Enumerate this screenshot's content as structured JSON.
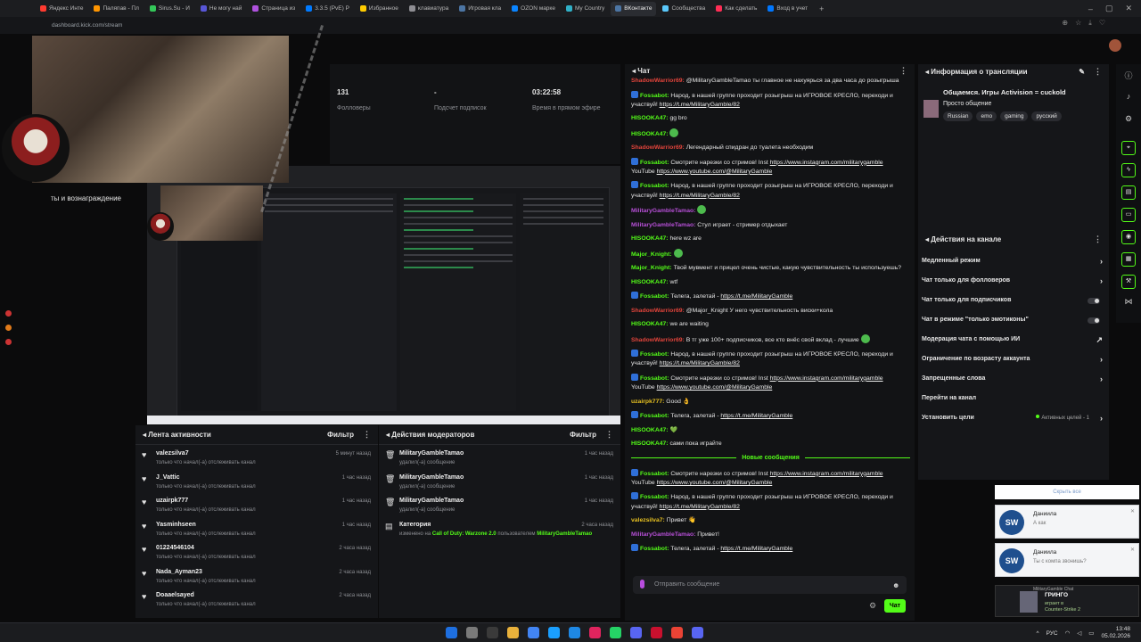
{
  "browser": {
    "tabs": [
      "Яндекс Инте",
      "Паляпав - Пл",
      "Sirus.Su - И",
      "Не могу най",
      "Страница из",
      "3.3.5 (PvE) Р",
      "Избранное",
      "клавиатура",
      "Игровая кла",
      "OZON марке",
      "My Country",
      "ВКонтакте",
      "Сообщества",
      "Как сделать",
      "Вход в учет"
    ],
    "active_tab": "ВКонтакте",
    "url": "dashboard.kick.com/stream"
  },
  "stats": [
    {
      "value": "131",
      "label": "Фолловеры"
    },
    {
      "value": "-",
      "label": "Подсчет подписок"
    },
    {
      "value": "03:22:58",
      "label": "Время в прямом эфире"
    }
  ],
  "stream": {
    "rewards_label": "ты и вознаграждение"
  },
  "activity": {
    "title": "Лента активности",
    "filter": "Фильтр",
    "items": [
      {
        "name": "valezsilva7",
        "sub": "только что начал(-а) отслеживать канал",
        "time": "5 минут назад"
      },
      {
        "name": "J_Vattic",
        "sub": "только что начал(-а) отслеживать канал",
        "time": "1 час назад"
      },
      {
        "name": "uzairpk777",
        "sub": "только что начал(-а) отслеживать канал",
        "time": "1 час назад"
      },
      {
        "name": "Yasminhseen",
        "sub": "только что начал(-а) отслеживать канал",
        "time": "1 час назад"
      },
      {
        "name": "01224546104",
        "sub": "только что начал(-а) отслеживать канал",
        "time": "2 часа назад"
      },
      {
        "name": "Nada_Ayman23",
        "sub": "только что начал(-а) отслеживать канал",
        "time": "2 часа назад"
      },
      {
        "name": "Doaaelsayed",
        "sub": "только что начал(-а) отслеживать канал",
        "time": "2 часа назад"
      }
    ]
  },
  "mod": {
    "title": "Действия модераторов",
    "filter": "Фильтр",
    "items": [
      {
        "name": "MilitaryGambleTamao",
        "sub": "удалил(-а) сообщение",
        "time": "1 час назад"
      },
      {
        "name": "MilitaryGambleTamao",
        "sub": "удалил(-а) сообщение",
        "time": "1 час назад"
      },
      {
        "name": "MilitaryGambleTamao",
        "sub": "удалил(-а) сообщение",
        "time": "1 час назад"
      }
    ],
    "category": {
      "name": "Категория",
      "time": "2 часа назад",
      "pre": "изменено на",
      "game": "Call of Duty: Warzone 2.0",
      "mid": "пользователем",
      "user": "MilitaryGambleTamao"
    }
  },
  "chat": {
    "title": "Чат",
    "colors": {
      "bot": "#53fc18",
      "red": "#e2443b",
      "mod": "#b64fd6",
      "user_green": "#53fc18",
      "yellow": "#e6c021"
    },
    "new_messages": "Новые сообщения",
    "placeholder": "Отправить сообщение",
    "send": "Чат",
    "messages": [
      {
        "user": "ShadowWarrior69",
        "color": "red",
        "text": "@MilitaryGambleTamao ты главное не нахуярься за два часа до розыгрыша"
      },
      {
        "user": "Fossabot",
        "color": "bot",
        "badge": true,
        "text": "Народ, в нашей группе проходит розыгрыш на ИГРОВОЕ КРЕСЛО, переходи и участвуй!",
        "link": "https://t.me/MilitaryGamble/82"
      },
      {
        "user": "HISOOKA47",
        "color": "bot",
        "text": "gg bro"
      },
      {
        "user": "HISOOKA47",
        "color": "bot",
        "text": "",
        "emote": true
      },
      {
        "user": "ShadowWarrior69",
        "color": "red",
        "text": "Легендарный спидран до туалета необходим"
      },
      {
        "user": "Fossabot",
        "color": "bot",
        "badge": true,
        "text": "Смотрите нарезки со стримов! Inst",
        "link": "https://www.instagram.com/militarygamble",
        "text2": "YouTube",
        "link2": "https://www.youtube.com/@MilitaryGamble"
      },
      {
        "user": "Fossabot",
        "color": "bot",
        "badge": true,
        "text": "Народ, в нашей группе проходит розыгрыш на ИГРОВОЕ КРЕСЛО, переходи и участвуй!",
        "link": "https://t.me/MilitaryGamble/82"
      },
      {
        "user": "MilitaryGambleTamao",
        "color": "mod",
        "text": "",
        "emote": true
      },
      {
        "user": "MilitaryGambleTamao",
        "color": "mod",
        "text": "Стул играет - стример отдыхает"
      },
      {
        "user": "HISOOKA47",
        "color": "bot",
        "text": "here wz are"
      },
      {
        "user": "Major_Knight",
        "color": "bot",
        "text": "",
        "emote": true
      },
      {
        "user": "Major_Knight",
        "color": "bot",
        "text": "Твой мувмент и прицел очень чистые, какую чувствительность ты используешь?"
      },
      {
        "user": "HISOOKA47",
        "color": "bot",
        "text": "wtf"
      },
      {
        "user": "Fossabot",
        "color": "bot",
        "badge": true,
        "text": "Телега, залетай -",
        "link": "https://t.me/MilitaryGamble"
      },
      {
        "user": "ShadowWarrior69",
        "color": "red",
        "text": "@Major_Knight У него чувствительность виски+кола"
      },
      {
        "user": "HISOOKA47",
        "color": "bot",
        "text": "we are waiting"
      },
      {
        "user": "ShadowWarrior69",
        "color": "red",
        "text": "В тг уже 100+ подписчиков, все кто внёс свой вклад - лучшие",
        "emote": true
      },
      {
        "user": "Fossabot",
        "color": "bot",
        "badge": true,
        "text": "Народ, в нашей группе проходит розыгрыш на ИГРОВОЕ КРЕСЛО, переходи и участвуй!",
        "link": "https://t.me/MilitaryGamble/82"
      },
      {
        "user": "Fossabot",
        "color": "bot",
        "badge": true,
        "text": "Смотрите нарезки со стримов! Inst",
        "link": "https://www.instagram.com/militarygamble",
        "text2": "YouTube",
        "link2": "https://www.youtube.com/@MilitaryGamble"
      },
      {
        "user": "uzairpk777",
        "color": "yellow",
        "text": "Good 👌"
      },
      {
        "user": "Fossabot",
        "color": "bot",
        "badge": true,
        "text": "Телега, залетай -",
        "link": "https://t.me/MilitaryGamble"
      },
      {
        "user": "HISOOKA47",
        "color": "bot",
        "text": "💚"
      },
      {
        "user": "HISOOKA47",
        "color": "bot",
        "text": "сами пока играйте"
      }
    ],
    "new_messages_list": [
      {
        "user": "Fossabot",
        "color": "bot",
        "badge": true,
        "text": "Смотрите нарезки со стримов! Inst",
        "link": "https://www.instagram.com/militarygamble",
        "text2": "YouTube",
        "link2": "https://www.youtube.com/@MilitaryGamble"
      },
      {
        "user": "Fossabot",
        "color": "bot",
        "badge": true,
        "text": "Народ, в нашей группе проходит розыгрыш на ИГРОВОЕ КРЕСЛО, переходи и участвуй!",
        "link": "https://t.me/MilitaryGamble/82"
      },
      {
        "user": "valezsilva7",
        "color": "yellow",
        "text": "Привет 👋"
      },
      {
        "user": "MilitaryGambleTamao",
        "color": "mod",
        "text": "Привет!"
      },
      {
        "user": "Fossabot",
        "color": "bot",
        "badge": true,
        "text": "Телега, залетай -",
        "link": "https://t.me/MilitaryGamble"
      }
    ]
  },
  "info": {
    "title": "Информация о трансляции",
    "stream_title": "Общаемся. Игры Activision = cuckold",
    "category": "Просто общение",
    "tags": [
      "Russian",
      "emo",
      "gaming",
      "русский"
    ]
  },
  "actions": {
    "title": "Действия на канале",
    "items": [
      {
        "label": "Медленный режим",
        "kind": "arrow"
      },
      {
        "label": "Чат только для фолловеров",
        "kind": "arrow"
      },
      {
        "label": "Чат только для подписчиков",
        "kind": "toggle"
      },
      {
        "label": "Чат в режиме \"только эмотиконы\"",
        "kind": "toggle"
      },
      {
        "label": "Модерация чата с помощью ИИ",
        "kind": "ext"
      },
      {
        "label": "Ограничение по возрасту аккаунта",
        "kind": "arrow"
      },
      {
        "label": "Запрещенные слова",
        "kind": "arrow"
      },
      {
        "label": "Перейти на канал",
        "kind": "none"
      },
      {
        "label": "Установить цели",
        "kind": "goal",
        "sub": "Активных целей - 1"
      }
    ]
  },
  "notifications": {
    "hide_all": "Скрыть все",
    "items": [
      {
        "name": "Даниила",
        "msg": "А как"
      },
      {
        "name": "Даниила",
        "msg": "Ты с компа звонишь?"
      }
    ],
    "game": {
      "name": "ГРИНГО",
      "status": "играет в",
      "title": "Counter-Strike 2",
      "header": "MilitaryGamble Chat"
    }
  },
  "taskbar": {
    "lang": "РУС",
    "time": "13:48",
    "date": "05.02.2026"
  }
}
